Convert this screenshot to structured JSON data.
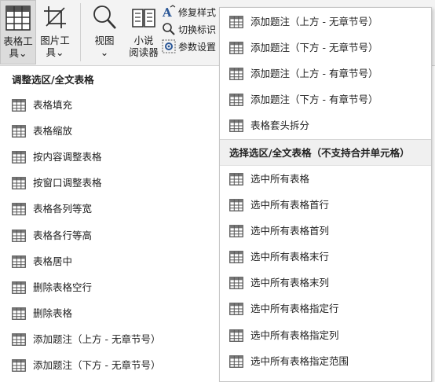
{
  "ribbon": {
    "table_tools": {
      "line1": "表格工",
      "line2": "具",
      "arrow": "⌄",
      "icon": "table-grid-icon"
    },
    "picture_tools": {
      "line1": "图片工",
      "line2": "具",
      "arrow": "⌄",
      "icon": "crop-icon"
    },
    "view": {
      "label": "视图",
      "arrow": "⌄",
      "icon": "magnifier-icon"
    },
    "reader": {
      "line1": "小说",
      "line2": "阅读器",
      "icon": "book-icon"
    },
    "small_items": [
      {
        "label": "修复样式",
        "icon": "font-size-a-icon"
      },
      {
        "label": "切换标识",
        "icon": "search-icon"
      },
      {
        "label": "参数设置",
        "icon": "settings-gear-icon"
      }
    ]
  },
  "left_menu": {
    "section_title": "调整选区/全文表格",
    "items": [
      "表格填充",
      "表格缩放",
      "按内容调整表格",
      "按窗口调整表格",
      "表格各列等宽",
      "表格各行等高",
      "表格居中",
      "删除表格空行",
      "删除表格",
      "添加题注（上方 - 无章节号）",
      "添加题注（下方 - 无章节号）"
    ]
  },
  "right_menu": {
    "items_top": [
      "添加题注（上方 - 无章节号）",
      "添加题注（下方 - 无章节号）",
      "添加题注（上方 - 有章节号）",
      "添加题注（下方 - 有章节号）",
      "表格套头拆分"
    ],
    "section_title": "选择选区/全文表格（不支持合并单元格）",
    "items_bottom": [
      "选中所有表格",
      "选中所有表格首行",
      "选中所有表格首列",
      "选中所有表格末行",
      "选中所有表格末列",
      "选中所有表格指定行",
      "选中所有表格指定列",
      "选中所有表格指定范围"
    ]
  }
}
